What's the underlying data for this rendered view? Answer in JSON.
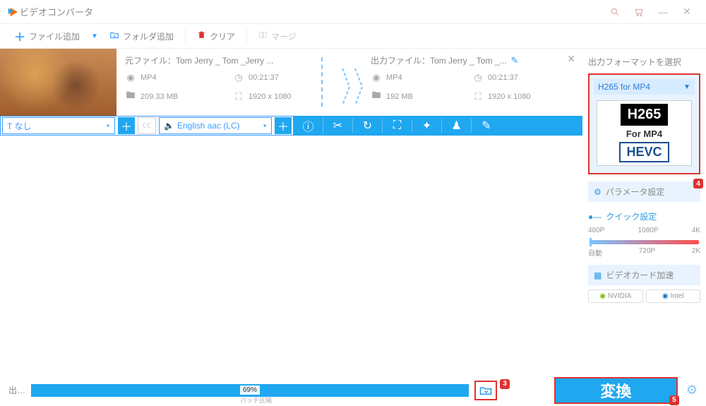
{
  "titlebar": {
    "title": "ビデオコンバータ"
  },
  "toolbar": {
    "add_file": "ファイル追加",
    "add_folder": "フォルダ追加",
    "clear": "クリア",
    "merge": "マージ"
  },
  "file": {
    "source_prefix": "元ファイル：",
    "source_name": "Tom  Jerry _ Tom _Jerry ...",
    "output_prefix": "出力ファイル：",
    "output_name": "Tom  Jerry _ Tom _...",
    "src": {
      "format": "MP4",
      "duration": "00:21:37",
      "size": "209.33 MB",
      "resolution": "1920 x 1080"
    },
    "out": {
      "format": "MP4",
      "duration": "00:21:37",
      "size": "192 MB",
      "resolution": "1920 x 1080"
    }
  },
  "actionbar": {
    "subtitle_label": "T なし",
    "cc": "CC",
    "audio_label": "English aac (LC)"
  },
  "right": {
    "section_title": "出力フォーマットを選択",
    "format_name": "H265 for MP4",
    "h265": "H265",
    "for_mp4": "For MP4",
    "hevc": "HEVC",
    "param_label": "パラメータ設定",
    "quick_label": "クイック設定",
    "quality_top": {
      "a": "480P",
      "b": "1080P",
      "c": "4K"
    },
    "quality_bottom": {
      "a": "自動",
      "b": "720P",
      "c": "2K"
    },
    "gpu_label": "ビデオカード加速",
    "nvidia": "NVIDIA",
    "intel": "Intel",
    "badge4": "4",
    "badge5": "5",
    "badge3": "3"
  },
  "bottom": {
    "out_label": "出…",
    "progress_pct": "69%",
    "convert": "変換",
    "batch": "バッチ圧縮"
  }
}
